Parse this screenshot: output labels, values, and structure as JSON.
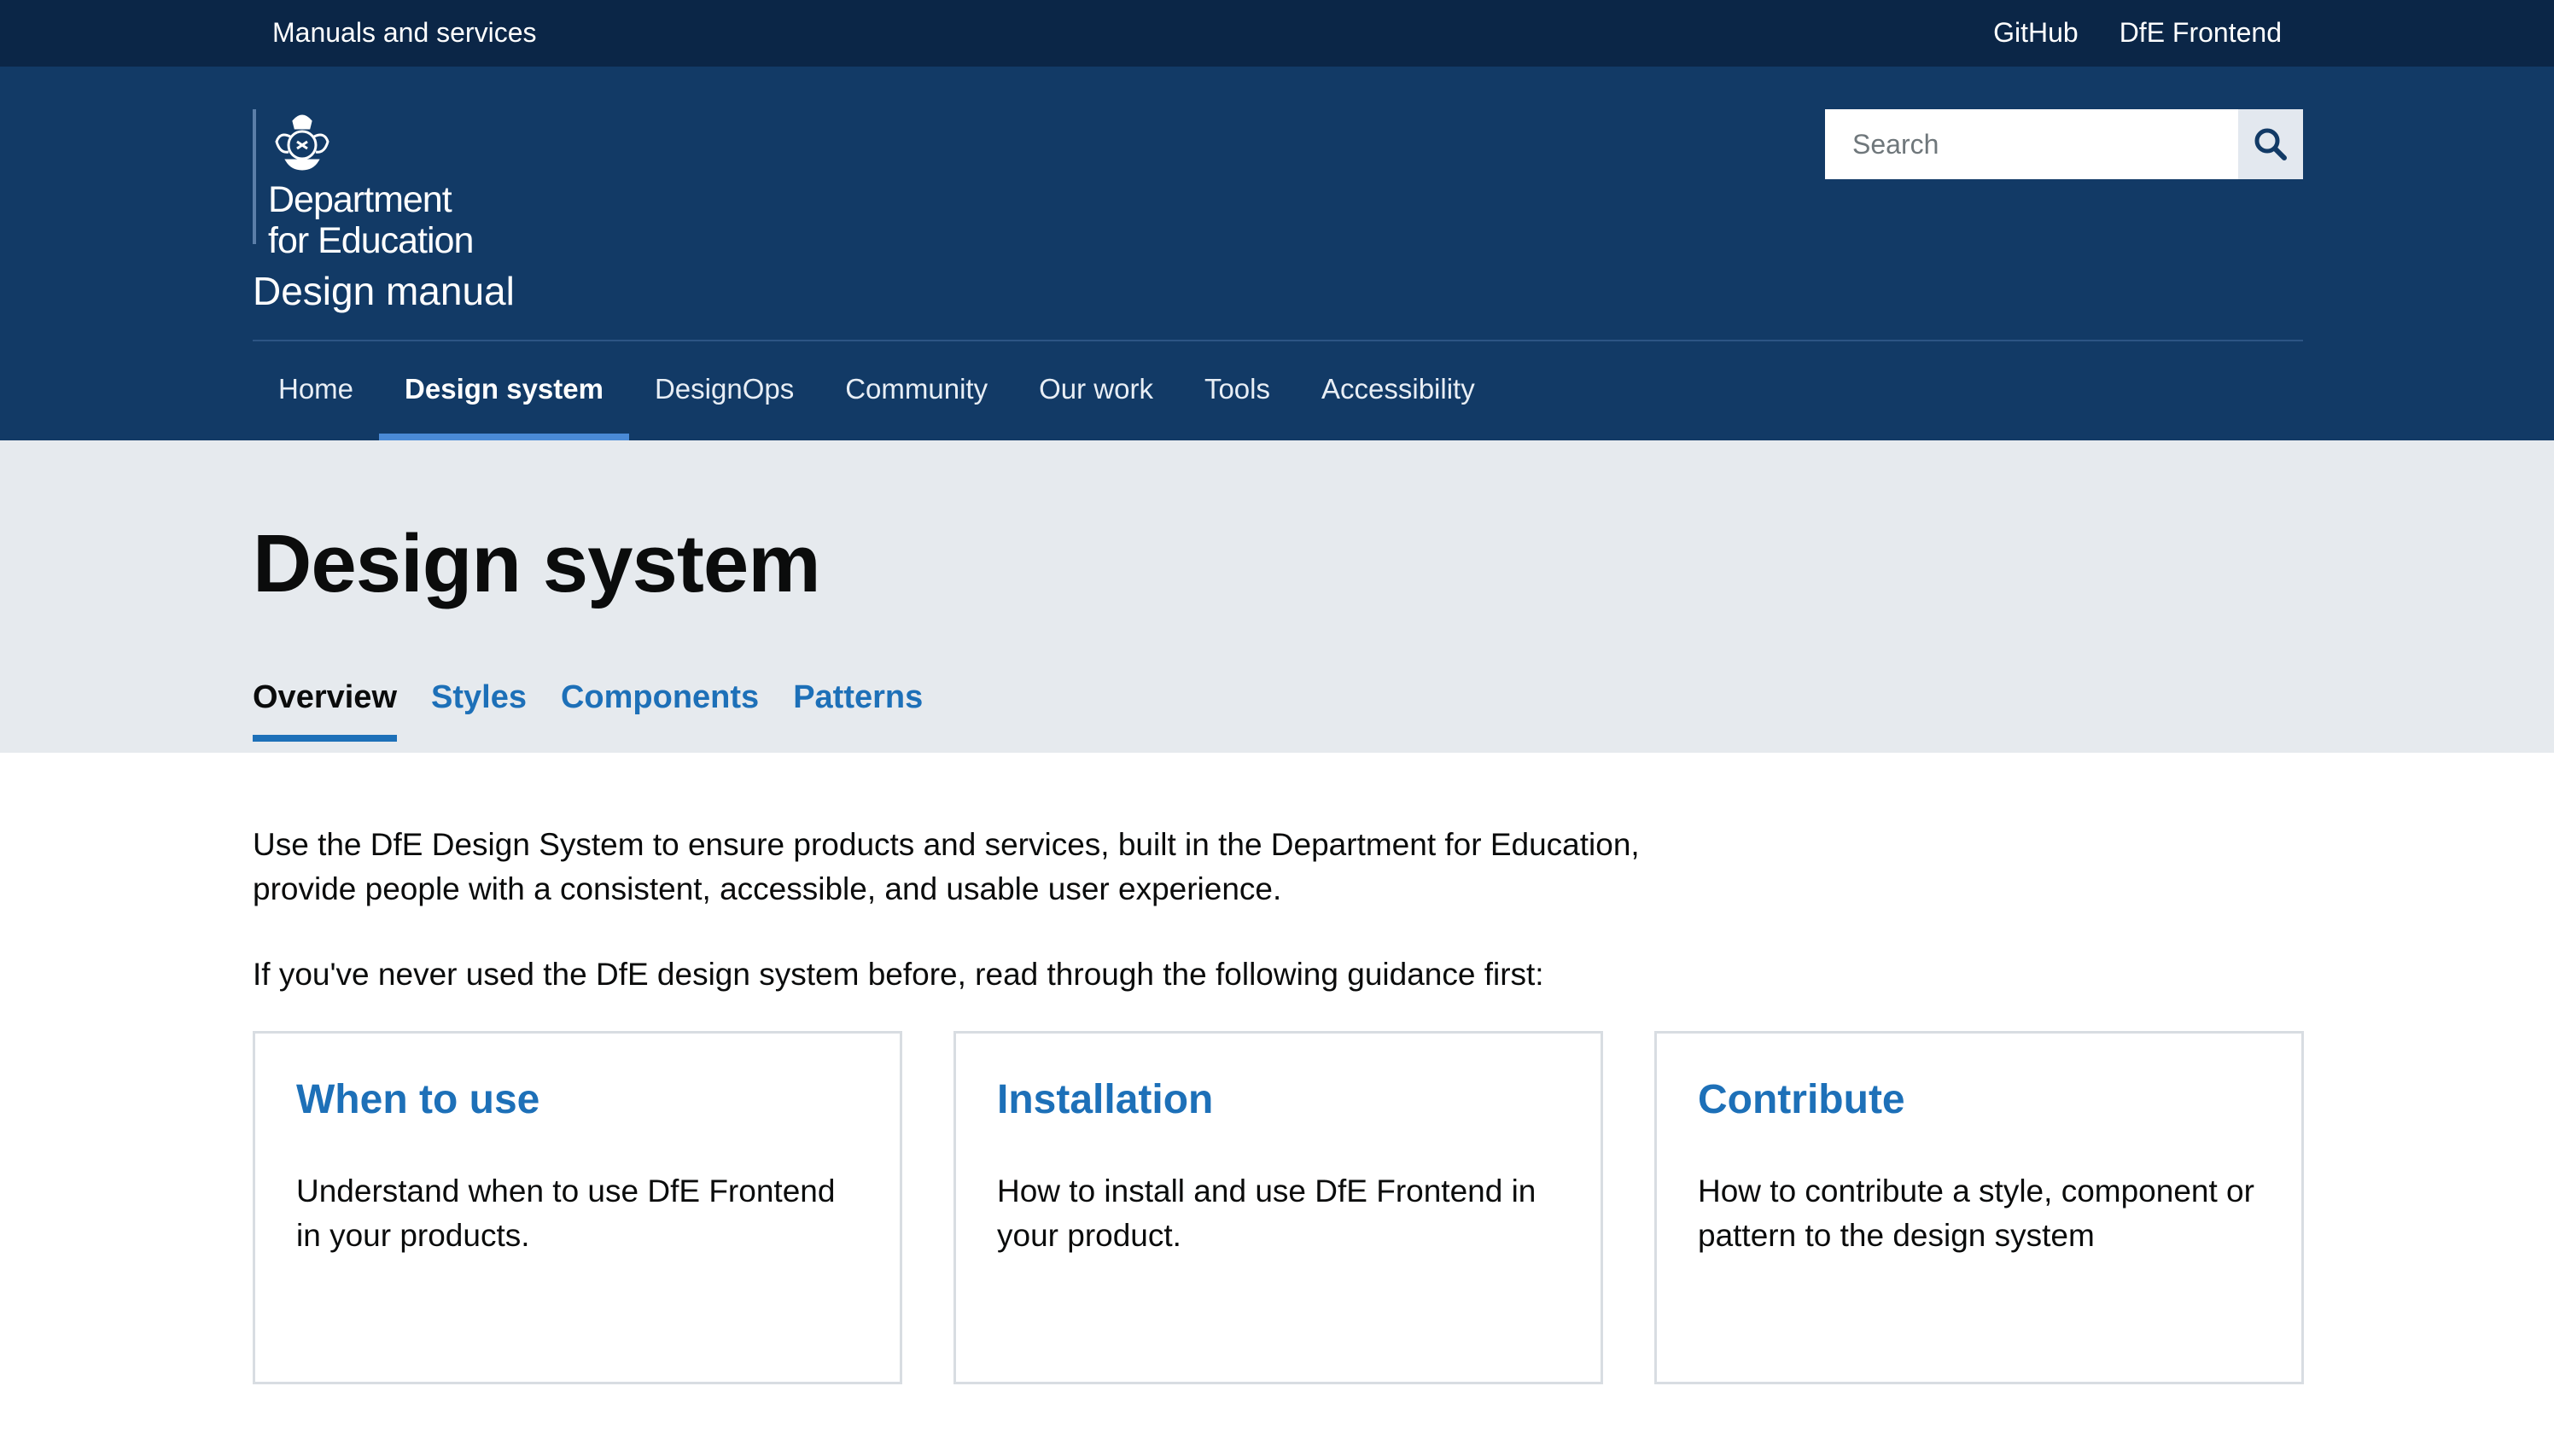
{
  "topbar": {
    "brand": "Manuals and services",
    "links": [
      "GitHub",
      "DfE Frontend"
    ]
  },
  "header": {
    "org_line1": "Department",
    "org_line2": "for Education",
    "site_title": "Design manual",
    "search_placeholder": "Search"
  },
  "nav": {
    "items": [
      "Home",
      "Design system",
      "DesignOps",
      "Community",
      "Our work",
      "Tools",
      "Accessibility"
    ],
    "active": "Design system"
  },
  "page": {
    "title": "Design system",
    "tabs": [
      "Overview",
      "Styles",
      "Components",
      "Patterns"
    ],
    "active_tab": "Overview",
    "intro": "Use the DfE Design System to ensure products and services, built in the Department for Education, provide people with a consistent, accessible, and usable user experience.",
    "lead": "If you've never used the DfE design system before, read through the following guidance first:"
  },
  "cards": [
    {
      "title": "When to use",
      "text": "Understand when to use DfE Frontend in your products."
    },
    {
      "title": "Installation",
      "text": "How to install and use DfE Frontend in your product."
    },
    {
      "title": "Contribute",
      "text": "How to contribute a style, component or pattern to the design system"
    }
  ],
  "colors": {
    "topbar": "#0b2647",
    "header": "#123a66",
    "link": "#1d70b8",
    "band": "#e6eaee"
  }
}
